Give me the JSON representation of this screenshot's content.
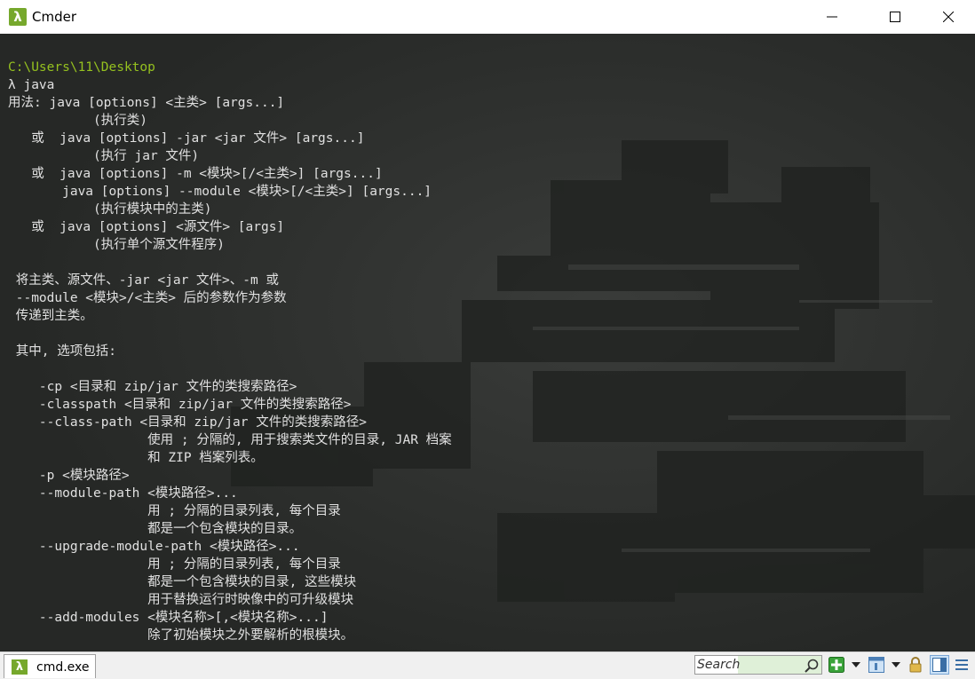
{
  "window": {
    "title": "Cmder",
    "app_icon_glyph": "λ",
    "minimize_icon": "minimize-icon",
    "maximize_icon": "maximize-icon",
    "close_icon": "close-icon"
  },
  "terminal": {
    "path_color": "#95c11f",
    "text_color": "#e0e0e0",
    "lines": [
      {
        "text": "C:\\Users\\11\\Desktop",
        "cls": "path"
      },
      {
        "text": "λ java",
        "cls": ""
      },
      {
        "text": "用法: java [options] <主类> [args...]",
        "cls": ""
      },
      {
        "text": "           (执行类)",
        "cls": ""
      },
      {
        "text": "   或  java [options] -jar <jar 文件> [args...]",
        "cls": ""
      },
      {
        "text": "           (执行 jar 文件)",
        "cls": ""
      },
      {
        "text": "   或  java [options] -m <模块>[/<主类>] [args...]",
        "cls": ""
      },
      {
        "text": "       java [options] --module <模块>[/<主类>] [args...]",
        "cls": ""
      },
      {
        "text": "           (执行模块中的主类)",
        "cls": ""
      },
      {
        "text": "   或  java [options] <源文件> [args]",
        "cls": ""
      },
      {
        "text": "           (执行单个源文件程序)",
        "cls": ""
      },
      {
        "text": "",
        "cls": ""
      },
      {
        "text": " 将主类、源文件、-jar <jar 文件>、-m 或",
        "cls": ""
      },
      {
        "text": " --module <模块>/<主类> 后的参数作为参数",
        "cls": ""
      },
      {
        "text": " 传递到主类。",
        "cls": ""
      },
      {
        "text": "",
        "cls": ""
      },
      {
        "text": " 其中, 选项包括:",
        "cls": ""
      },
      {
        "text": "",
        "cls": ""
      },
      {
        "text": "    -cp <目录和 zip/jar 文件的类搜索路径>",
        "cls": ""
      },
      {
        "text": "    -classpath <目录和 zip/jar 文件的类搜索路径>",
        "cls": ""
      },
      {
        "text": "    --class-path <目录和 zip/jar 文件的类搜索路径>",
        "cls": ""
      },
      {
        "text": "                  使用 ; 分隔的, 用于搜索类文件的目录, JAR 档案",
        "cls": ""
      },
      {
        "text": "                  和 ZIP 档案列表。",
        "cls": ""
      },
      {
        "text": "    -p <模块路径>",
        "cls": ""
      },
      {
        "text": "    --module-path <模块路径>...",
        "cls": ""
      },
      {
        "text": "                  用 ; 分隔的目录列表, 每个目录",
        "cls": ""
      },
      {
        "text": "                  都是一个包含模块的目录。",
        "cls": ""
      },
      {
        "text": "    --upgrade-module-path <模块路径>...",
        "cls": ""
      },
      {
        "text": "                  用 ; 分隔的目录列表, 每个目录",
        "cls": ""
      },
      {
        "text": "                  都是一个包含模块的目录, 这些模块",
        "cls": ""
      },
      {
        "text": "                  用于替换运行时映像中的可升级模块",
        "cls": ""
      },
      {
        "text": "    --add-modules <模块名称>[,<模块名称>...]",
        "cls": ""
      },
      {
        "text": "                  除了初始模块之外要解析的根模块。",
        "cls": ""
      }
    ]
  },
  "statusbar": {
    "tab_label": "cmd.exe",
    "tab_icon_glyph": "λ",
    "search_placeholder": "Search",
    "icons": [
      "search-icon",
      "new-console-icon",
      "console-dropdown-icon",
      "window-list-icon",
      "window-list-dropdown-icon",
      "lock-icon",
      "split-view-icon",
      "menu-icon"
    ]
  }
}
